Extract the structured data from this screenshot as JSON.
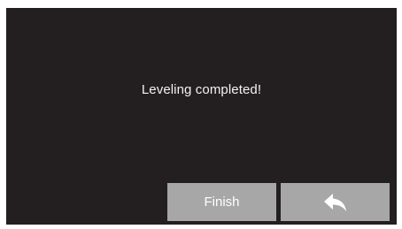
{
  "dialog": {
    "message": "Leveling completed!"
  },
  "buttons": {
    "finish_label": "Finish",
    "back_icon": "back-arrow-icon"
  },
  "colors": {
    "screen_background": "#231f20",
    "button_background": "#a8a7a8",
    "text": "#f2f2f2"
  }
}
